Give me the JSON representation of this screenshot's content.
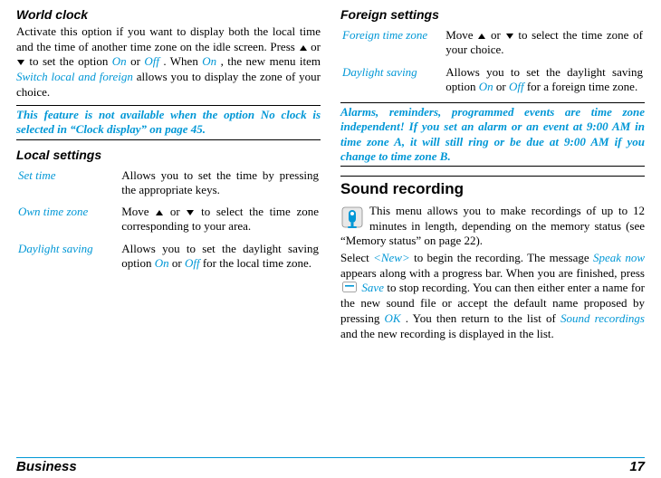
{
  "left": {
    "worldClock": {
      "title": "World clock",
      "p1a": "Activate this option if you want to display both the local time and the time of another time zone on the idle screen. Press ",
      "p1b": " or ",
      "p1c": " to set the option ",
      "on": "On",
      "p1d": " or ",
      "off": "Off",
      "p1e": ". When ",
      "p1f": ", the new menu item ",
      "switch": "Switch local and foreign",
      "p1g": " allows you to display the zone of your choice."
    },
    "callout1a": "This feature is not available when the option ",
    "callout1b": "No clock",
    "callout1c": " is selected in “Clock display” on page 45.",
    "localSettings": {
      "title": "Local settings",
      "rows": {
        "setTime": {
          "k": "Set time",
          "v": "Allows you to set the time by pressing the appropriate keys."
        },
        "ownZone": {
          "k": "Own time zone",
          "va": "Move ",
          "vb": " or ",
          "vc": " to select the time zone corresponding to your area."
        },
        "daylight": {
          "k": "Daylight saving",
          "va": "Allows you to set the daylight saving option ",
          "on": "On",
          "mid": " or ",
          "off": "Off",
          "vb": " for the local time zone."
        }
      }
    }
  },
  "right": {
    "foreignSettings": {
      "title": "Foreign settings",
      "rows": {
        "zone": {
          "k": "Foreign time zone",
          "va": "Move ",
          "vb": " or ",
          "vc": " to select the time zone of your choice."
        },
        "daylight": {
          "k": "Daylight saving",
          "va": "Allows you to set the daylight saving option ",
          "on": "On",
          "mid": " or ",
          "off": "Off",
          "vb": " for a foreign time zone."
        }
      }
    },
    "callout2": "Alarms, reminders, programmed events are time zone independent! If you set an alarm or an event at 9:00 AM in time zone A, it will still ring or be due at 9:00 AM if you change to time zone B.",
    "sound": {
      "title": "Sound recording",
      "p1": "This menu allows you to make recordings of up to 12 minutes in length, depending on the memory status (see “Memory status” on page 22).",
      "p2a": "Select ",
      "new": "<New>",
      "p2b": " to begin the recording. The message ",
      "speak": "Speak now",
      "p2c": " appears along with a progress bar. When you are finished, press ",
      "save": "Save",
      "p2d": " to stop recording. You can then either enter a name for the new sound file or accept the default name proposed by pressing ",
      "ok": "OK",
      "p2e": ". You then return to the list of ",
      "rec": "Sound recordings",
      "p2f": " and the new recording is displayed in the list."
    }
  },
  "footer": {
    "left": "Business",
    "right": "17"
  }
}
